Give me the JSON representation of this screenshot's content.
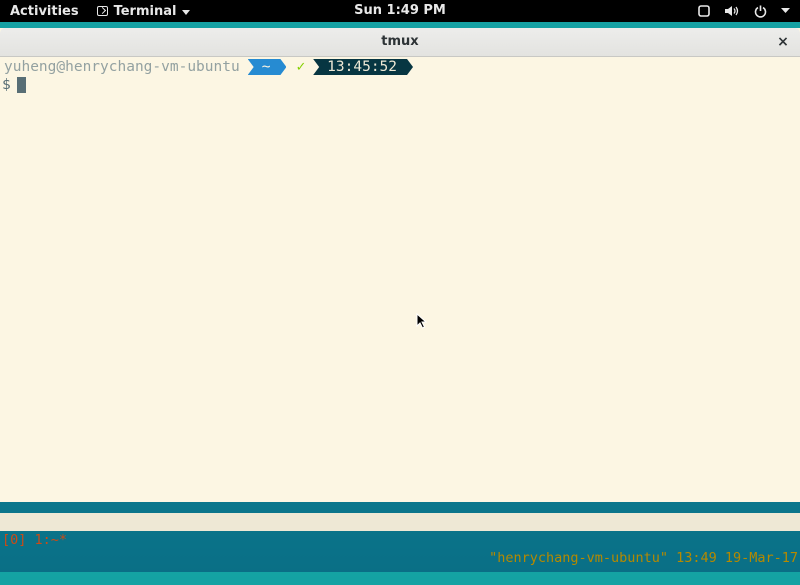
{
  "topbar": {
    "activities": "Activities",
    "app_menu": "Terminal",
    "clock": "Sun  1:49 PM",
    "icons": [
      "window-icon",
      "volume-icon",
      "power-icon",
      "chevron-down-icon"
    ]
  },
  "window": {
    "title": "tmux",
    "close": "×"
  },
  "terminal": {
    "prompt": {
      "user_host": "yuheng@henrychang-vm-ubuntu",
      "path": "~",
      "status_mark": "✓",
      "time": "13:45:52"
    },
    "input_prompt": "$"
  },
  "tmux": {
    "left": "[0] 1:~*",
    "right": "\"henrychang-vm-ubuntu\" 13:49 19-Mar-17"
  },
  "colors": {
    "terminal_bg": "#fcf6e3",
    "path_segment": "#268bd2",
    "time_segment": "#073642",
    "check": "#85d000",
    "tmux_left": "#cb4b16",
    "tmux_right": "#b58900",
    "desktop": "#14a3a3"
  }
}
